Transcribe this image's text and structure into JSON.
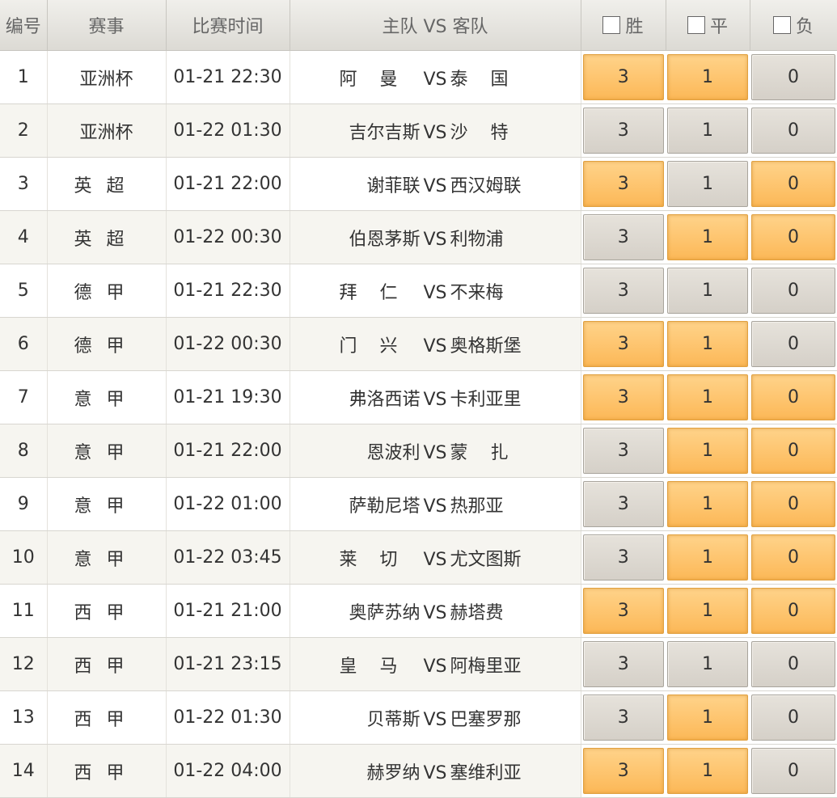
{
  "header": {
    "num": "编号",
    "league": "赛事",
    "time": "比赛时间",
    "teams": "主队 VS 客队",
    "win": "胜",
    "draw": "平",
    "lose": "负"
  },
  "vs": "VS",
  "colors": {
    "selected": "#fcb857",
    "unselected": "#d9d4cc",
    "team_text": "#1f4b8c"
  },
  "rows": [
    {
      "num": "1",
      "league": "亚洲杯",
      "time": "01-21 22:30",
      "home": "阿曼",
      "away": "泰国",
      "w": "3",
      "d": "1",
      "l": "0",
      "sel": [
        true,
        true,
        false
      ]
    },
    {
      "num": "2",
      "league": "亚洲杯",
      "time": "01-22 01:30",
      "home": "吉尔吉斯",
      "away": "沙特",
      "w": "3",
      "d": "1",
      "l": "0",
      "sel": [
        false,
        false,
        false
      ]
    },
    {
      "num": "3",
      "league": "英超",
      "time": "01-21 22:00",
      "home": "谢菲联",
      "away": "西汉姆联",
      "w": "3",
      "d": "1",
      "l": "0",
      "sel": [
        true,
        false,
        true
      ]
    },
    {
      "num": "4",
      "league": "英超",
      "time": "01-22 00:30",
      "home": "伯恩茅斯",
      "away": "利物浦",
      "w": "3",
      "d": "1",
      "l": "0",
      "sel": [
        false,
        true,
        true
      ]
    },
    {
      "num": "5",
      "league": "德甲",
      "time": "01-21 22:30",
      "home": "拜仁",
      "away": "不来梅",
      "w": "3",
      "d": "1",
      "l": "0",
      "sel": [
        false,
        false,
        false
      ]
    },
    {
      "num": "6",
      "league": "德甲",
      "time": "01-22 00:30",
      "home": "门兴",
      "away": "奥格斯堡",
      "w": "3",
      "d": "1",
      "l": "0",
      "sel": [
        true,
        true,
        false
      ]
    },
    {
      "num": "7",
      "league": "意甲",
      "time": "01-21 19:30",
      "home": "弗洛西诺",
      "away": "卡利亚里",
      "w": "3",
      "d": "1",
      "l": "0",
      "sel": [
        true,
        true,
        true
      ]
    },
    {
      "num": "8",
      "league": "意甲",
      "time": "01-21 22:00",
      "home": "恩波利",
      "away": "蒙扎",
      "w": "3",
      "d": "1",
      "l": "0",
      "sel": [
        false,
        true,
        true
      ]
    },
    {
      "num": "9",
      "league": "意甲",
      "time": "01-22 01:00",
      "home": "萨勒尼塔",
      "away": "热那亚",
      "w": "3",
      "d": "1",
      "l": "0",
      "sel": [
        false,
        true,
        true
      ]
    },
    {
      "num": "10",
      "league": "意甲",
      "time": "01-22 03:45",
      "home": "莱切",
      "away": "尤文图斯",
      "w": "3",
      "d": "1",
      "l": "0",
      "sel": [
        false,
        true,
        true
      ]
    },
    {
      "num": "11",
      "league": "西甲",
      "time": "01-21 21:00",
      "home": "奥萨苏纳",
      "away": "赫塔费",
      "w": "3",
      "d": "1",
      "l": "0",
      "sel": [
        true,
        true,
        true
      ]
    },
    {
      "num": "12",
      "league": "西甲",
      "time": "01-21 23:15",
      "home": "皇马",
      "away": "阿梅里亚",
      "w": "3",
      "d": "1",
      "l": "0",
      "sel": [
        false,
        false,
        false
      ]
    },
    {
      "num": "13",
      "league": "西甲",
      "time": "01-22 01:30",
      "home": "贝蒂斯",
      "away": "巴塞罗那",
      "w": "3",
      "d": "1",
      "l": "0",
      "sel": [
        false,
        true,
        false
      ]
    },
    {
      "num": "14",
      "league": "西甲",
      "time": "01-22 04:00",
      "home": "赫罗纳",
      "away": "塞维利亚",
      "w": "3",
      "d": "1",
      "l": "0",
      "sel": [
        true,
        true,
        false
      ]
    }
  ]
}
